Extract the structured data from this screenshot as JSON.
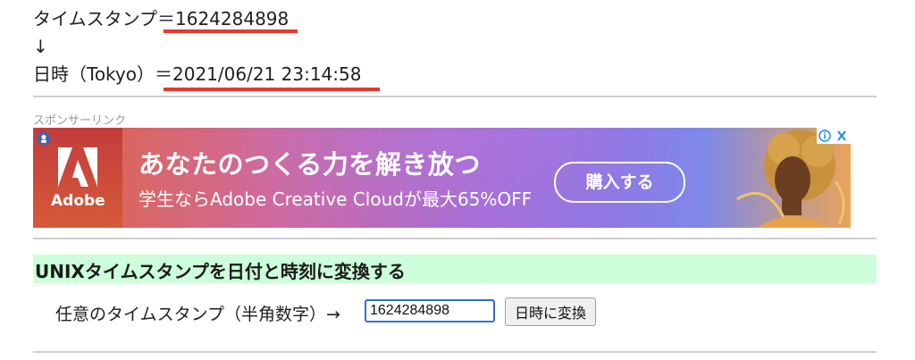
{
  "result": {
    "timestamp_label": "タイムスタンプ＝",
    "timestamp_value": "1624284898",
    "arrow": "↓",
    "datetime_label": "日時（Tokyo）＝",
    "datetime_value": "2021/06/21 23:14:58"
  },
  "sponsor": {
    "label": "スポンサーリンク"
  },
  "ad": {
    "logo_text": "Adobe",
    "headline": "あなたのつくる力を解き放つ",
    "subtext": "学生ならAdobe Creative Cloudが最大65%OFF",
    "cta": "購入する"
  },
  "converter": {
    "title": "UNIXタイムスタンプを日付と時刻に変換する",
    "field_label": "任意のタイムスタンプ（半角数字）→",
    "input_value": "1624284898",
    "button_label": "日時に変換"
  },
  "colors": {
    "underline": "#e53a2f",
    "section_bg": "#ccffd9",
    "input_border": "#2f6fd6"
  }
}
